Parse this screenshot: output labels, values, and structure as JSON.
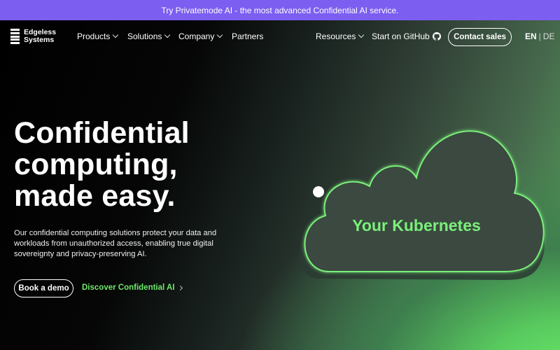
{
  "banner": {
    "text": "Try Privatemode AI - the most advanced Confidential AI service."
  },
  "nav": {
    "logo_line1": "Edgeless",
    "logo_line2": "Systems",
    "products": "Products",
    "solutions": "Solutions",
    "company": "Company",
    "partners": "Partners",
    "resources": "Resources",
    "github": "Start on GitHub",
    "contact": "Contact sales",
    "lang_en": "EN",
    "lang_sep": "|",
    "lang_de": "DE"
  },
  "hero": {
    "headline": [
      "Confidential",
      "computing,",
      "made easy."
    ],
    "description": "Our confidential computing solutions protect your data and workloads from unauthorized access, enabling true digital sovereignty and privacy-preserving AI.",
    "demo_button": "Book a demo",
    "discover_link": "Discover Confidential AI",
    "cloud_label": "Your Kubernetes"
  },
  "colors": {
    "banner": "#7c5ef0",
    "accent_green": "#6ee86a"
  }
}
